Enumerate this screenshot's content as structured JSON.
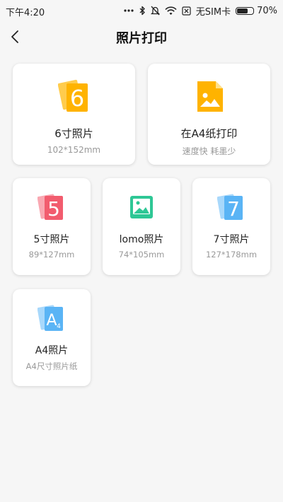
{
  "status_bar": {
    "time": "下午4:20",
    "sim": "无SIM卡",
    "battery": "70%",
    "battery_level": 0.7
  },
  "header": {
    "title": "照片打印"
  },
  "cards": [
    {
      "title": "6寸照片",
      "subtitle": "102*152mm",
      "icon": "photo-6-inch-icon"
    },
    {
      "title": "在A4纸打印",
      "subtitle": "速度快 耗墨少",
      "icon": "a4-document-image-icon"
    },
    {
      "title": "5寸照片",
      "subtitle": "89*127mm",
      "icon": "photo-5-inch-icon"
    },
    {
      "title": "lomo照片",
      "subtitle": "74*105mm",
      "icon": "lomo-photo-icon"
    },
    {
      "title": "7寸照片",
      "subtitle": "127*178mm",
      "icon": "photo-7-inch-icon"
    },
    {
      "title": "A4照片",
      "subtitle": "A4尺寸照片纸",
      "icon": "photo-a4-icon"
    }
  ],
  "colors": {
    "orange": "#ffb300",
    "orange_light": "#ffcc4d",
    "red": "#f25c6e",
    "red_light": "#f9a8b2",
    "green": "#2ec795",
    "blue": "#5ab4f5",
    "blue_light": "#a8d8fb"
  }
}
